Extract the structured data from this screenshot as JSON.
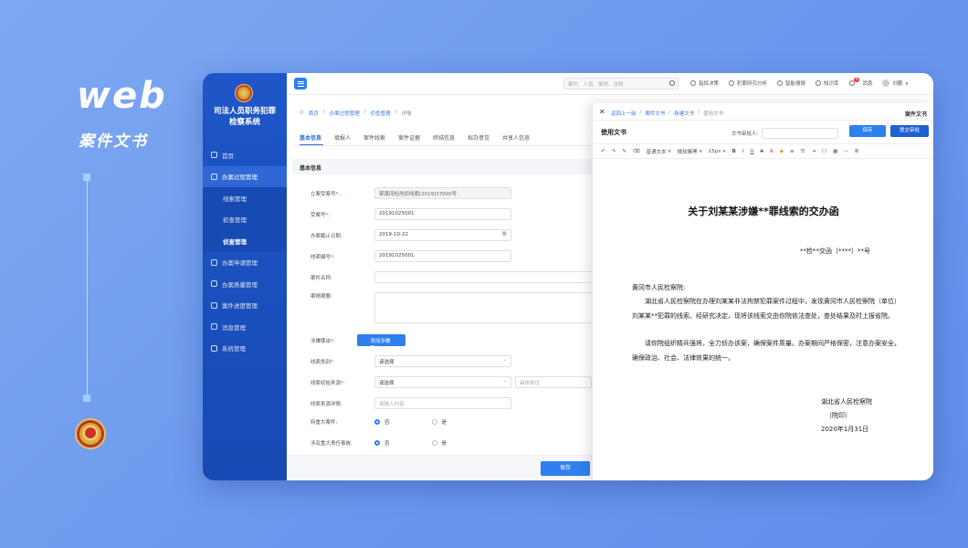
{
  "hero": {
    "title": "web",
    "subtitle": "案件文书"
  },
  "sidebar": {
    "system_title_line1": "司法人员职务犯罪",
    "system_title_line2": "检察系统",
    "items": [
      {
        "label": "首页",
        "type": "item"
      },
      {
        "label": "办案过程管理",
        "type": "parent"
      },
      {
        "label": "线索管理",
        "type": "sub"
      },
      {
        "label": "初查管理",
        "type": "sub"
      },
      {
        "label": "侦查管理",
        "type": "sub-active"
      },
      {
        "label": "办案申请管理",
        "type": "item"
      },
      {
        "label": "办案质量管理",
        "type": "item"
      },
      {
        "label": "案件进度管理",
        "type": "item"
      },
      {
        "label": "消息管理",
        "type": "item"
      },
      {
        "label": "系统管理",
        "type": "item"
      }
    ]
  },
  "topbar": {
    "search_placeholder": "案件、人员、案例、法规",
    "tools": [
      "指挥决策",
      "犯罪研究分析",
      "智能搜报",
      "知识库",
      "消息"
    ],
    "message_badge": "3",
    "user": "刘鹏"
  },
  "breadcrumb": [
    "首页",
    "办案过程管理",
    "侦查管理",
    "详情"
  ],
  "tabs": [
    "基本信息",
    "填报人",
    "案件线索",
    "案件证据",
    "终结信息",
    "拟办意见",
    "共享人信息"
  ],
  "form": {
    "section": "基本信息",
    "fields": [
      {
        "label": "立案受案号",
        "required": true,
        "value": "鄂黄冈检刑侦线索[2019]37000号"
      },
      {
        "label": "受案号",
        "required": true,
        "value": "20191025001"
      },
      {
        "label": "办案截止日期",
        "required": false,
        "value": "2019-10-22"
      },
      {
        "label": "线索编号",
        "required": true,
        "value": "20191025001"
      },
      {
        "label": "案件名称",
        "required": false,
        "value": ""
      },
      {
        "label": "案情摘要",
        "required": false,
        "value": ""
      },
      {
        "label": "涉嫌罪由",
        "required": true,
        "value": "添加涉嫌罪由"
      },
      {
        "label": "线索类别",
        "required": true,
        "value": "请选择"
      },
      {
        "label": "线索初始来源",
        "required": true,
        "value": "请选择",
        "extra": "具体单位"
      },
      {
        "label": "线索来源详情",
        "required": false,
        "value": "请输入内容"
      },
      {
        "label": "特重大案件",
        "required": false,
        "options": [
          "否",
          "是"
        ]
      },
      {
        "label": "涉及重大责任事故",
        "required": false,
        "options": [
          "否",
          "是"
        ]
      }
    ],
    "save": "保存"
  },
  "panel": {
    "breadcrumb": [
      "返回上一级",
      "案件文书",
      "新建文书",
      "使用文书"
    ],
    "header_right": "案件文书",
    "title": "使用文书",
    "review_label": "文书审批人:",
    "save": "保存",
    "submit": "提交审批",
    "toolbar": [
      "普通文本",
      "微软雅黑",
      "15px",
      "B",
      "I",
      "U",
      "S"
    ],
    "doc": {
      "title": "关于刘某某涉嫌**罪线索的交办函",
      "ref": "**检**交函〔****〕**号",
      "to": "黄冈市人民检察院:",
      "para1": "湖北省人民检察院在办理刘某某非法拘禁犯罪案件过程中，发现黄冈市人民检察院（单位）刘某某**犯罪的线索。经研究决定，现将该线索交由你院依法查处，查处结果及时上报省院。",
      "para2": "请你院组织精兵强将，全力侦办该案，确保案件质量。办案期间严格保密，注意办案安全，确保政治、社会、法律效果的统一。",
      "org": "湖北省人民检察院",
      "seal": "（院印）",
      "date": "2020年1月31日"
    }
  }
}
